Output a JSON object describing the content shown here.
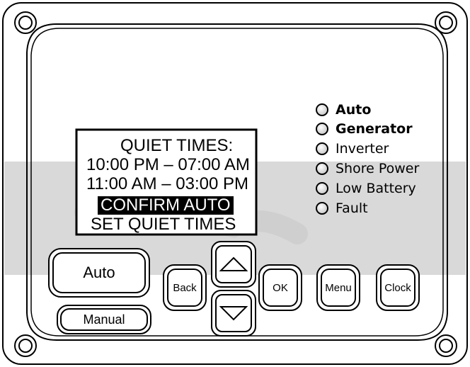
{
  "lcd": {
    "title": "QUIET TIMES:",
    "time_range_1": "10:00 PM – 07:00 AM",
    "time_range_2": "11:00 AM – 03:00 PM",
    "menu_selected": "CONFIRM AUTO",
    "menu_option": "SET QUIET TIMES"
  },
  "indicators": {
    "auto": "Auto",
    "generator": "Generator",
    "inverter": "Inverter",
    "shore_power": "Shore Power",
    "low_battery": "Low Battery",
    "fault": "Fault"
  },
  "buttons": {
    "auto": "Auto",
    "manual": "Manual",
    "back": "Back",
    "ok": "OK",
    "menu": "Menu",
    "clock": "Clock"
  },
  "icons": {
    "up": "triangle-up-icon",
    "down": "triangle-down-icon",
    "screw": "screw-icon"
  },
  "colors": {
    "outline": "#000000",
    "watermark": "#d9d9d9",
    "highlight_bg": "#000000",
    "highlight_text": "#ffffff"
  }
}
